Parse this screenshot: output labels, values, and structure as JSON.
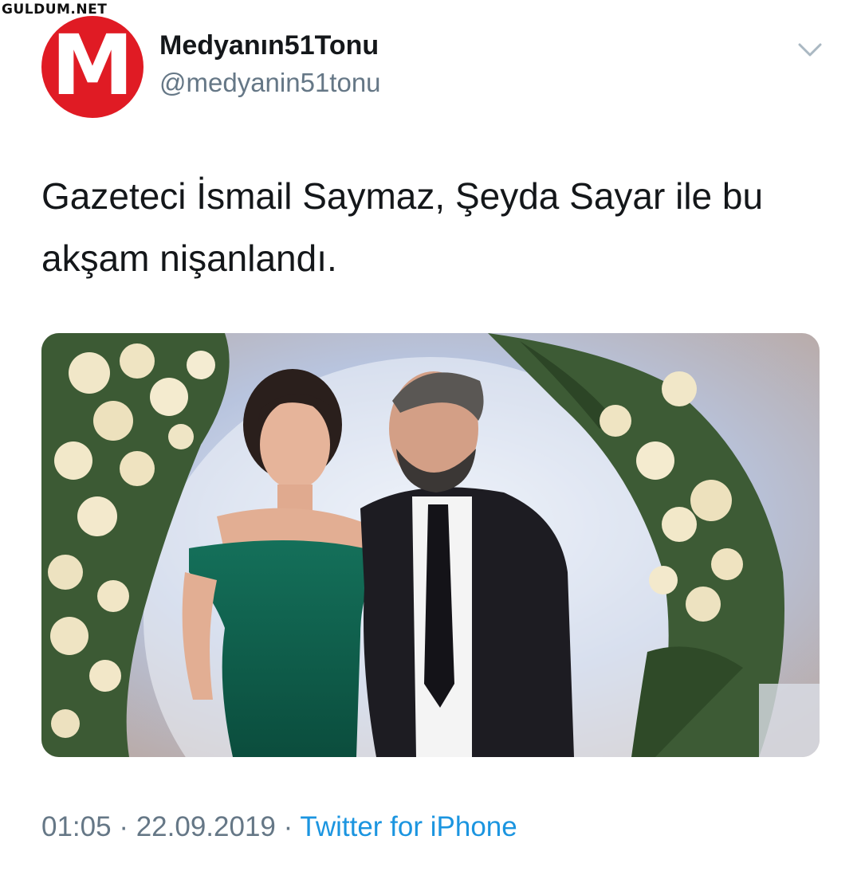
{
  "watermark": "GULDUM.NET",
  "tweet": {
    "avatar": {
      "letter": "M",
      "bg_color": "#e01b24"
    },
    "display_name": "Medyanın51Tonu",
    "handle": "@medyanin51tonu",
    "text": "Gazeteci İsmail Saymaz, Şeyda Sayar ile bu akşam nişanlandı.",
    "media_alt": "Engagement photo: smiling woman in green off-shoulder dress beside a bearded man in a black suit, in front of a floral arch",
    "time": "01:05",
    "separator": "·",
    "date": "22.09.2019",
    "source": "Twitter for iPhone",
    "menu_icon": "chevron-down-icon"
  },
  "colors": {
    "text_primary": "#14171a",
    "text_secondary": "#657786",
    "link": "#1b95e0"
  }
}
